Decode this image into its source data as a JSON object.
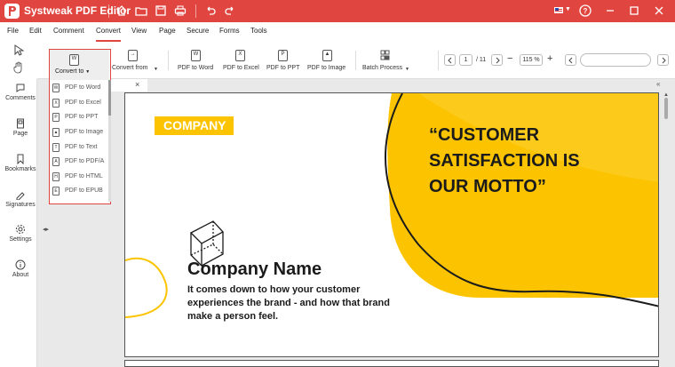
{
  "app": {
    "title": "Systweak PDF Editor"
  },
  "menu": {
    "items": [
      "File",
      "Edit",
      "Comment",
      "Convert",
      "View",
      "Page",
      "Secure",
      "Forms",
      "Tools"
    ],
    "active": "Convert"
  },
  "ribbon": {
    "convert_from": "Convert from",
    "buttons": [
      {
        "label": "PDF to Word",
        "glyph": "W"
      },
      {
        "label": "PDF to Excel",
        "glyph": "X"
      },
      {
        "label": "PDF to PPT",
        "glyph": "P"
      },
      {
        "label": "PDF to Image",
        "glyph": "▲"
      }
    ],
    "batch": "Batch Process"
  },
  "pager": {
    "current": "1",
    "total": "/ 11"
  },
  "zoom": {
    "value": "115 %"
  },
  "sidebar": {
    "items": [
      "Comments",
      "Page",
      "Bookmarks",
      "Signatures",
      "Settings",
      "About"
    ]
  },
  "dropdown": {
    "header": "Convert to",
    "header_glyph": "W",
    "items": [
      {
        "label": "PDF to Word",
        "glyph": "W"
      },
      {
        "label": "PDF to Excel",
        "glyph": "X"
      },
      {
        "label": "PDF to PPT",
        "glyph": "P"
      },
      {
        "label": "PDF to Image",
        "glyph": "▲"
      },
      {
        "label": "PDF to Text",
        "glyph": "T"
      },
      {
        "label": "PDF to PDF/A",
        "glyph": "A"
      },
      {
        "label": "PDF to HTML",
        "glyph": "H"
      },
      {
        "label": "PDF to EPUB",
        "glyph": "E"
      }
    ]
  },
  "document": {
    "company_label": "COMPANY",
    "slogan_lines": [
      "“CUSTOMER",
      "SATISFACTION IS",
      "OUR MOTTO”"
    ],
    "company_name": "Company Name",
    "tagline_lines": [
      "It comes down to how your customer",
      "experiences the brand - and how that brand",
      "make a person feel."
    ]
  },
  "colors": {
    "accent": "#e0463f",
    "brand_yellow": "#fcc400"
  }
}
